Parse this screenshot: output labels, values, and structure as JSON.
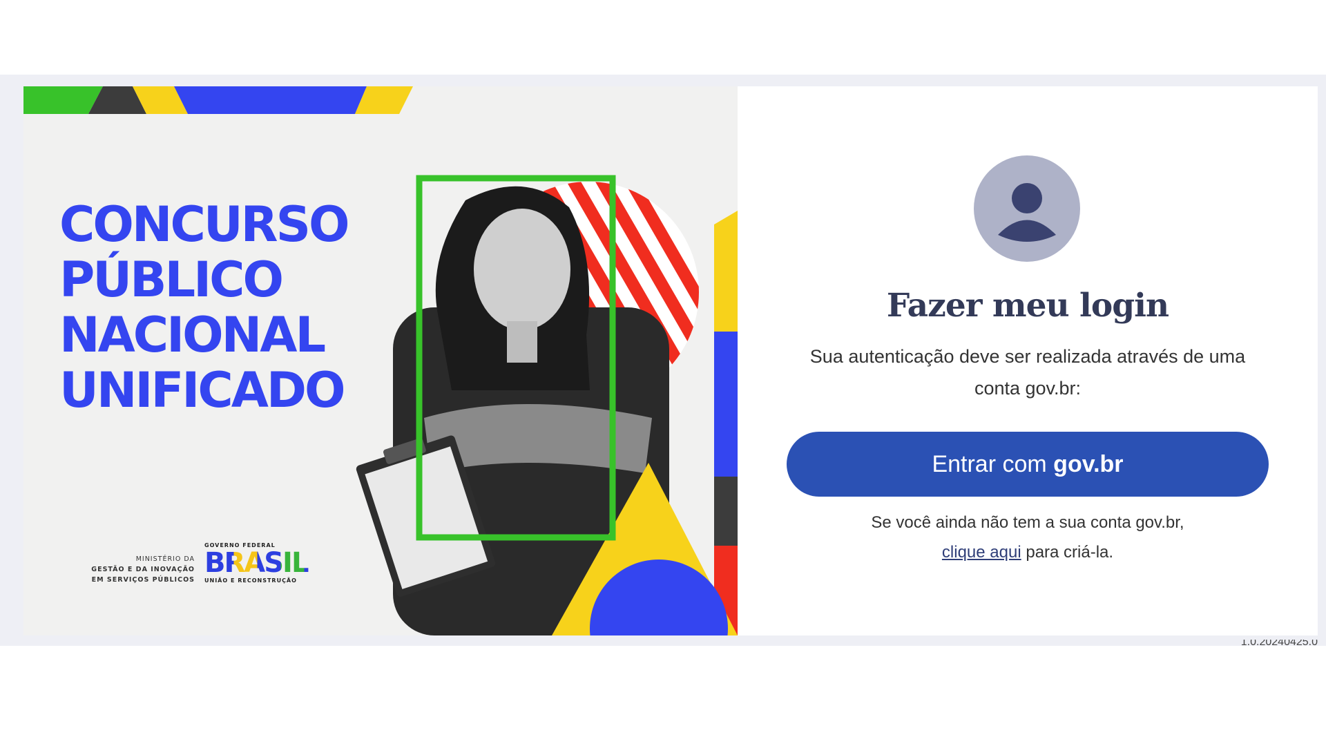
{
  "banner": {
    "title_lines": [
      "Concurso",
      "Público",
      "Nacional",
      "Unificado"
    ],
    "ministry": {
      "line1": "MINISTÉRIO DA",
      "line2": "GESTÃO E DA INOVAÇÃO",
      "line3": "EM SERVIÇOS PÚBLICOS"
    },
    "gov_logo": {
      "top": "GOVERNO FEDERAL",
      "word": "BRASIL",
      "bottom": "UNIÃO E RECONSTRUÇÃO"
    },
    "colors": {
      "blue": "#3445f0",
      "green": "#38c22a",
      "yellow": "#f7d21b",
      "red": "#f02d1f",
      "dark": "#3c3c3c"
    }
  },
  "login": {
    "avatar_icon": "user-avatar-icon",
    "title": "Fazer meu login",
    "description": "Sua autenticação deve ser realizada através de uma conta gov.br:",
    "button_prefix": "Entrar com ",
    "button_strong": "gov.br",
    "signup_text": "Se você ainda não tem a sua conta gov.br,",
    "signup_link": "clique aqui",
    "signup_suffix": " para criá-la.",
    "button_color": "#2b51b4"
  },
  "footer": {
    "version": "1.0.20240425.0"
  }
}
